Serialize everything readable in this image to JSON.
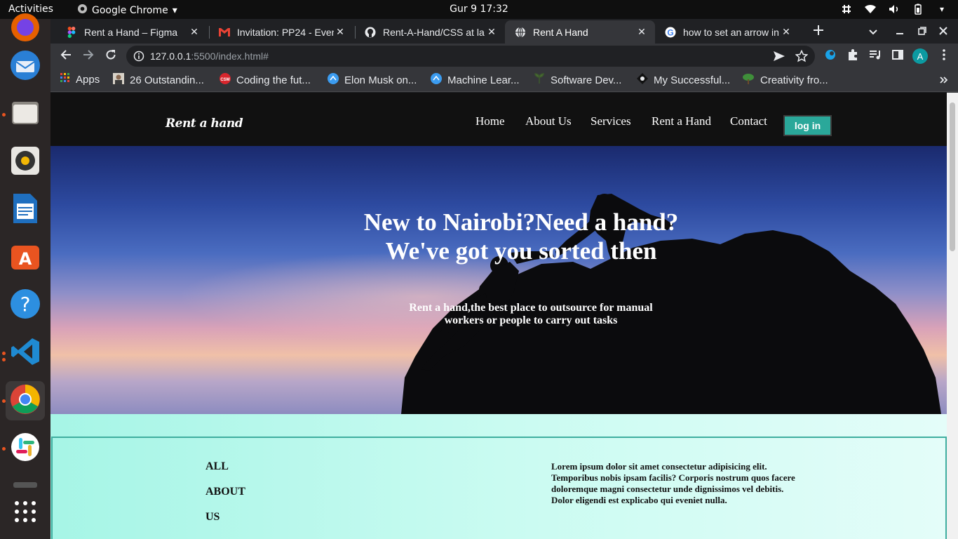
{
  "topbar": {
    "activities": "Activities",
    "app_name": "Google Chrome",
    "clock": "Gur 9  17:32"
  },
  "tabs": [
    {
      "title": "Rent a Hand – Figma",
      "favicon": "figma-icon"
    },
    {
      "title": "Invitation: PP24 - Even",
      "favicon": "gmail-icon"
    },
    {
      "title": "Rent-A-Hand/CSS at la",
      "favicon": "github-icon"
    },
    {
      "title": "Rent A Hand",
      "favicon": "globe-icon",
      "active": true
    },
    {
      "title": "how to set an arrow in",
      "favicon": "google-icon"
    }
  ],
  "address": {
    "host": "127.0.0.1",
    "path": ":5500/index.html#"
  },
  "bookmarks": [
    {
      "label": "Apps",
      "icon": "apps-grid-icon"
    },
    {
      "label": "26 Outstandin...",
      "icon": "portrait-icon"
    },
    {
      "label": "Coding the fut...",
      "icon": "csm-icon"
    },
    {
      "label": "Elon Musk on...",
      "icon": "site-icon"
    },
    {
      "label": "Machine Lear...",
      "icon": "site-icon"
    },
    {
      "label": "Software Dev...",
      "icon": "leaf-icon"
    },
    {
      "label": "My Successful...",
      "icon": "medium-icon"
    },
    {
      "label": "Creativity fro...",
      "icon": "tree-icon"
    }
  ],
  "profile_initial": "A",
  "site": {
    "logo": "Rent a hand",
    "nav": [
      "Home",
      "About Us",
      "Services",
      "Rent a Hand",
      "Contact"
    ],
    "login": "log in",
    "hero_title_1": "New to Nairobi?Need a hand?",
    "hero_title_2": "We've got you sorted then",
    "hero_sub": "Rent a hand,the best place to outsource for manual workers or people to carry out tasks",
    "about_words": [
      "ALL",
      "ABOUT",
      "US"
    ],
    "about_text": "Lorem ipsum dolor sit amet consectetur adipisicing elit. Temporibus nobis ipsam facilis? Corporis nostrum quos facere doloremque magni consectetur unde dignissimos vel debitis. Dolor eligendi est explicabo qui eveniet nulla."
  },
  "colors": {
    "accent_button": "#2aa89a",
    "nav_bg": "#111111",
    "about_bg": "#a6f5e6"
  }
}
